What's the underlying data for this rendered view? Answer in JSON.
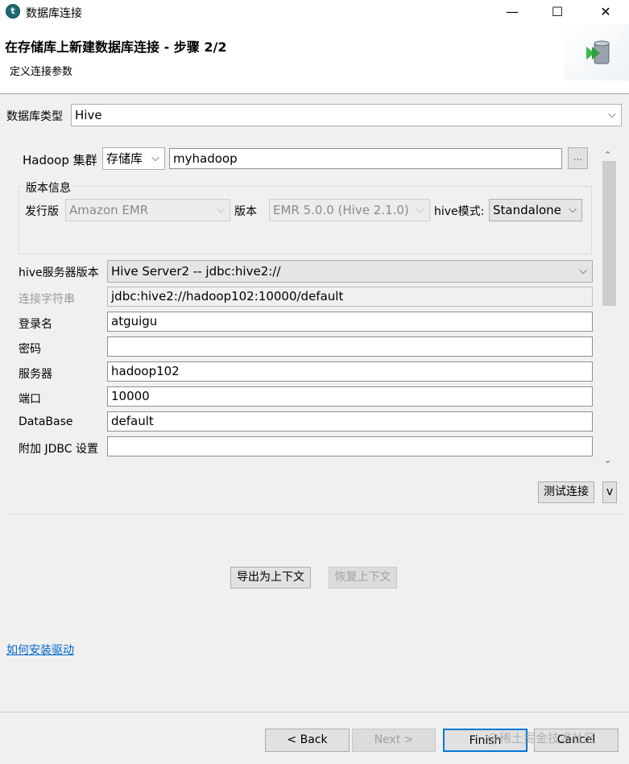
{
  "window": {
    "title": "数据库连接",
    "minimize": "—",
    "maximize": "☐",
    "close": "✕"
  },
  "header": {
    "title": "在存储库上新建数据库连接 - 步骤 2/2",
    "subtitle": "定义连接参数"
  },
  "db_type": {
    "label": "数据库类型",
    "value": "Hive"
  },
  "hadoop": {
    "label": "Hadoop 集群",
    "source": "存储库",
    "cluster": "myhadoop",
    "browse": "..."
  },
  "version_info": {
    "legend": "版本信息",
    "distribution_label": "发行版",
    "distribution": "Amazon EMR",
    "version_label": "版本",
    "version": "EMR 5.0.0 (Hive 2.1.0)",
    "mode_label": "hive模式:",
    "mode": "Standalone"
  },
  "server_version": {
    "label": "hive服务器版本",
    "value": "Hive Server2 -- jdbc:hive2://"
  },
  "fields": {
    "conn_string_label": "连接字符串",
    "conn_string": "jdbc:hive2://hadoop102:10000/default",
    "login_label": "登录名",
    "login": "atguigu",
    "password_label": "密码",
    "password": "",
    "server_label": "服务器",
    "server": "hadoop102",
    "port_label": "端口",
    "port": "10000",
    "database_label": "DataBase",
    "database": "default",
    "jdbc_label": "附加 JDBC 设置",
    "jdbc": ""
  },
  "actions": {
    "test": "测试连接",
    "test_more": "v",
    "export_ctx": "导出为上下文",
    "restore_ctx": "恢复上下文",
    "driver_link": "如何安装驱动"
  },
  "footer": {
    "back": "< Back",
    "next": "Next >",
    "finish": "Finish",
    "cancel": "Cancel",
    "watermark": "@稀土掘金技术社区"
  }
}
